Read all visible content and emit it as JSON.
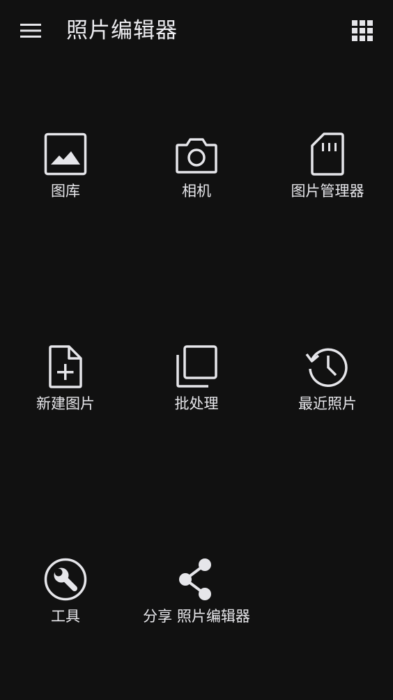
{
  "app_bar": {
    "title": "照片编辑器",
    "menu_icon": "hamburger-menu-icon",
    "apps_icon": "apps-grid-icon"
  },
  "tiles": [
    {
      "label": "图库",
      "icon": "image-gallery-icon"
    },
    {
      "label": "相机",
      "icon": "camera-icon"
    },
    {
      "label": "图片管理器",
      "icon": "sd-card-icon"
    },
    {
      "label": "新建图片",
      "icon": "new-file-icon"
    },
    {
      "label": "批处理",
      "icon": "batch-copy-icon"
    },
    {
      "label": "最近照片",
      "icon": "history-icon"
    },
    {
      "label": "工具",
      "icon": "wrench-icon"
    },
    {
      "label": "分享 照片编辑器",
      "icon": "share-icon"
    }
  ],
  "colors": {
    "background": "#111111",
    "foreground": "#e6e6ea"
  }
}
